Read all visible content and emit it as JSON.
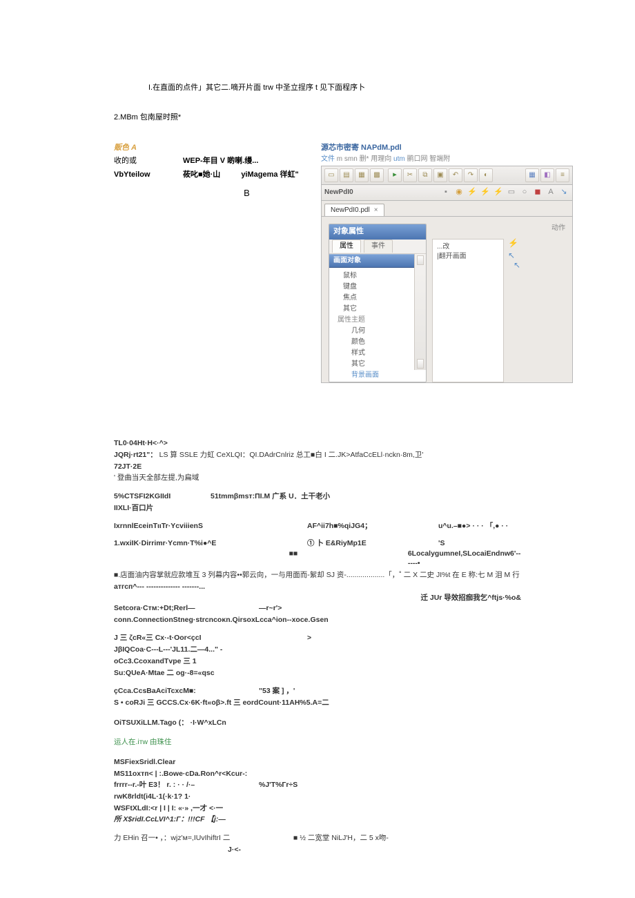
{
  "intro": {
    "line1": "I.在直面的点件」其它二.嘀开片面 trw 中圣立挰序 t 见下面程序卜",
    "line2": "2.MBm 包南屋时照*"
  },
  "color_table": {
    "title": "贩色 A",
    "r1c1": "收的或",
    "r1c2": "WEP-年目 V 啲喇.缦...",
    "r2c1": "VbYteilow",
    "r2c2": "莜叱■她·山",
    "r2c3": "yiMagema 徉虹\"",
    "big_b": "B"
  },
  "app": {
    "title": "源芯市密寄 NAPdM.pdl",
    "menu_1": "文件",
    "menu_2": "m smn",
    "menu_3": "删*",
    "menu_4": "用理向",
    "menu_5": "utm",
    "menu_6": "鹂口网",
    "menu_7": "智端附",
    "secondbar_label": "NewPdI0",
    "filetab": "NewPdI0.pdl",
    "filetab_close": "×",
    "panel_title": "对象属性",
    "tab_attr": "属性",
    "tab_event": "事件",
    "tree_group": "画面对象",
    "tree_items": [
      "鼠标",
      "键盘",
      "焦点",
      "其它"
    ],
    "tree_group2": "属性主题",
    "tree_items2": [
      "几何",
      "颜色",
      "样式",
      "其它",
      "背景画面"
    ],
    "rp_header": "动作",
    "rp_rows": [
      "...改",
      "|翻开画面"
    ]
  },
  "lower": {
    "l1": "TL0·04Ht·H<·^>",
    "l2a": "JQRj·rt21\"：",
    "l2b": "LS 算 SSLE 力虹 CeXLQI：QI.DAdrCnlriz 总工■白 I 二.JK>AtfaCcELl·nckn·8m,卫'",
    "l3": "72JT·2E",
    "l4": "'   登曲当天全部左提,为扁域",
    "l5a": "5%CTSFI2KGIIdI",
    "l5b": "51tmmβmsт:ΠI.M 广系 U．土干老小",
    "l6": "IIXLI·百口片",
    "l7a": "IxrnnlEceinTιιTr·YcviiienS",
    "l7b": "AF^ii7h■%qiJG4；",
    "l7c": "u^u.–■●> ·  ·  ·    「,● ·  ·",
    "l8a": "1.wxiIK·Dirrimr·Ycmn·T%i●^E",
    "l8b": "① 卜 E&RiyMp1E",
    "l8c": "'S",
    "l9a": "■■",
    "l9b": "6LocalygumneI,SLocaiEndnw6'------•",
    "l10": "■.店面油内容掌就应款堆互 3 列幕内容••郭云向，一与用面而-絮却 SJ 资-...................「，˚ 二 X 二史 JI%t 在 E 称:七 M 泪 M 行",
    "l11": "атгсп^--- -------------- -------...",
    "l12": "迁 JUr 导效招痂我乞^ftjs·%o&",
    "l13a": "Setcora·Cтм:+Dt;Rerl—",
    "l13b": "—r~r'>",
    "l14": "conn.ConnectionStneg·strcncoκn.QirsoxLcca^ion--xoce.Gsen",
    "l15a": "J 三 ζcR«三 Cx·-t·Oor<çcI",
    "l15b": ">",
    "l16": "JβIQCoa·C---L---'JL11.二—4...\" -",
    "l17": "oCc3.CcoxandTvpe 三 1",
    "l18": "Su:QUeA·Mtae 二 og·-8=«qsc",
    "l19a": "çCca.CcsBaAciTcxcM■:",
    "l19b": "\"53 案 ] ，'",
    "l20": "S • coRJi 三 GCCS.Cx·6K·ft«oβ>.ft 三 eordCount·11AH%5.A=二",
    "l21": "OiTSUXiLLM.Tago (： ·I·W^xLCn",
    "l22": "运人在.iтw 由珠住",
    "l23": "MSFiexSridl.Clear",
    "l24": "MS11oxтп< | :.Bowe·cDa.Ron^r<Kcur-:",
    "l25a": "frrrr--r.-叶 E3！ r.   :  ·  ·  /·–",
    "l25b": "%J'T%Гr÷S",
    "l26": "rwK8rldt(i4L·1(·k·1?                      1·",
    "l27": "WSFtXLdI:<r | I | I: «·» ,一才 <·一",
    "l28": "所 X$ridI.CcLVI^1:Г：!!!CF 【j:—",
    "l29a": "力 EHin 召一• ，：wjz'м=,IUvIhiftrI 二",
    "l29b": "■ ½ 二宽堂 NiLJ'H，二 5 x吻-",
    "l30": "J·<-"
  }
}
